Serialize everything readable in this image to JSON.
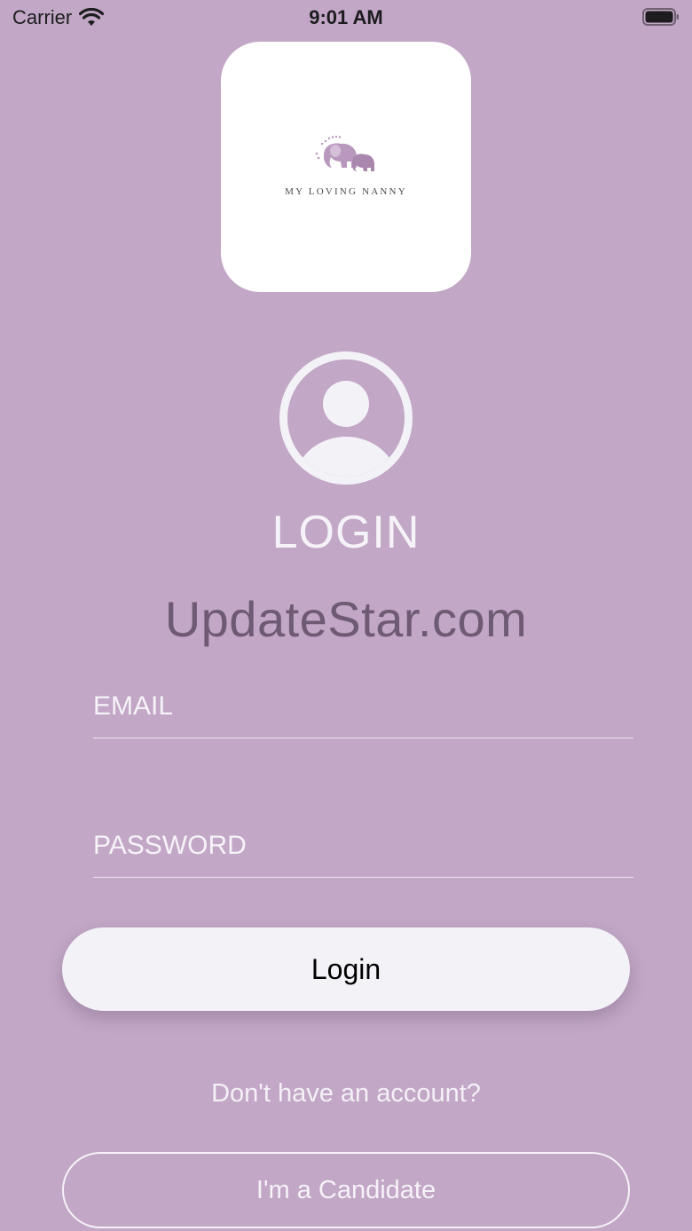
{
  "status_bar": {
    "carrier": "Carrier",
    "time": "9:01 AM",
    "icons": [
      "wifi-icon",
      "battery-icon"
    ]
  },
  "logo": {
    "brand_text": "MY LOVING NANNY",
    "icon": "elephant-logo-icon"
  },
  "avatar": {
    "icon": "user-circle-icon"
  },
  "title": "LOGIN",
  "watermark": "UpdateStar.com",
  "form": {
    "email_placeholder": "EMAIL",
    "password_placeholder": "PASSWORD",
    "login_label": "Login"
  },
  "signup": {
    "prompt": "Don't have an account?",
    "candidate_label": "I'm a Candidate"
  },
  "colors": {
    "background": "#c2a7c6",
    "logo_accent": "#b998bd",
    "button_fill": "#f2f2f7",
    "text_light": "#f5f3f7"
  }
}
